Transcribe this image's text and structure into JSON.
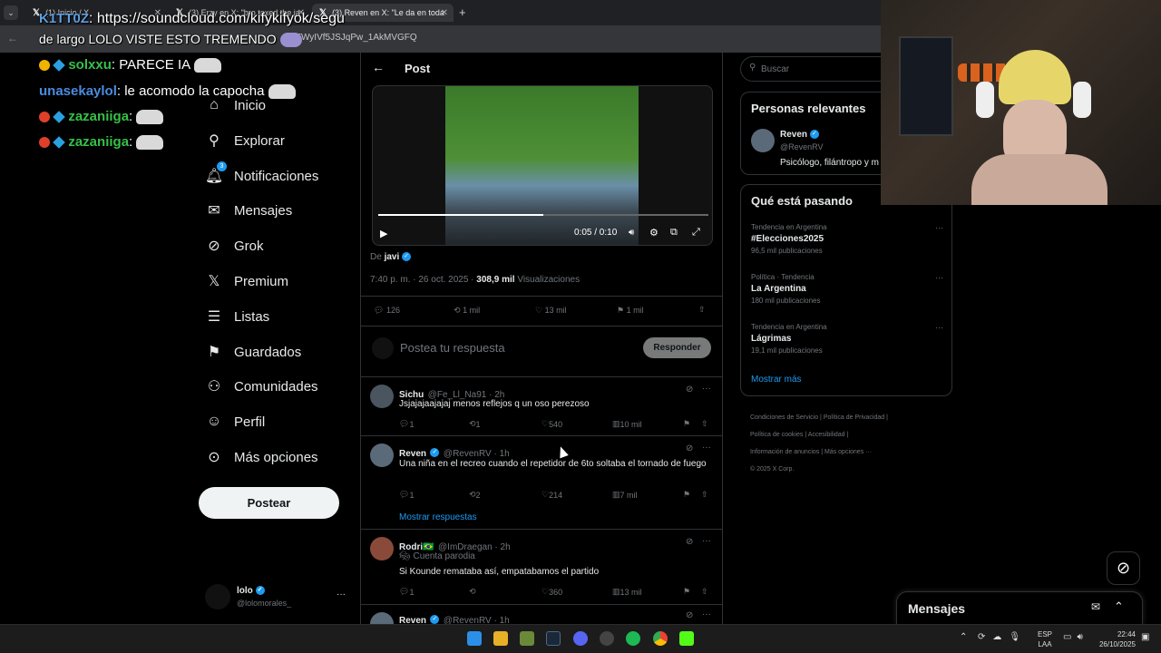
{
  "browser": {
    "tabs": [
      {
        "title": "(1) Inicio / X"
      },
      {
        "title": "(3) Erzy en X: \"bro taxed the ja"
      },
      {
        "title": "(3) Reven en X: \"Le da en toda"
      }
    ],
    "new_tab": "+",
    "url_fragment": "=TWyIVf5JSJqPw_1AkMVGFQ"
  },
  "chat": [
    {
      "name": "K1TT0Z",
      "msg": ": https://soundcloud.com/kifykifyok/segu"
    },
    {
      "name": "",
      "msg": "de largo LOLO VISTE ESTO TREMENDO"
    },
    {
      "name": "solxxu",
      "msg": ": PARECE IA"
    },
    {
      "name": "unasekaylol",
      "msg": ": le acomodo la capocha"
    },
    {
      "name": "zazaniiga",
      "msg": ":"
    },
    {
      "name": "zazaniiga",
      "msg": ":"
    }
  ],
  "nav": {
    "items": [
      {
        "label": "Inicio",
        "icon": "home-icon",
        "glyph": "⌂"
      },
      {
        "label": "Explorar",
        "icon": "search-icon",
        "glyph": "⚲"
      },
      {
        "label": "Notificaciones",
        "icon": "bell-icon",
        "glyph": "♫",
        "badge": "3"
      },
      {
        "label": "Mensajes",
        "icon": "mail-icon",
        "glyph": "✉"
      },
      {
        "label": "Grok",
        "icon": "grok-icon",
        "glyph": "⊘"
      },
      {
        "label": "Premium",
        "icon": "x-logo-icon",
        "glyph": "𝕏"
      },
      {
        "label": "Listas",
        "icon": "list-icon",
        "glyph": "☰"
      },
      {
        "label": "Guardados",
        "icon": "bookmark-icon",
        "glyph": "⚑"
      },
      {
        "label": "Comunidades",
        "icon": "people-icon",
        "glyph": "⚇"
      },
      {
        "label": "Perfil",
        "icon": "person-icon",
        "glyph": "☺"
      },
      {
        "label": "Más opciones",
        "icon": "more-circle-icon",
        "glyph": "⊙"
      }
    ],
    "post_button": "Postear",
    "account_name": "lolo",
    "account_handle": "@lolomorales_",
    "account_more": "···"
  },
  "post": {
    "header_title": "Post",
    "video_time": "0:05 / 0:10",
    "by_label": "De",
    "by_name": "javi",
    "meta_time": "7:40 p. m. · 26 oct. 2025 · ",
    "views_value": "308,9 mil",
    "views_label": "Visualizaciones",
    "stats": {
      "replies": "126",
      "reposts": "1 mil",
      "likes": "13 mil",
      "bookmarks": "1 mil"
    },
    "reply_placeholder": "Postea tu respuesta",
    "reply_button": "Responder"
  },
  "replies": [
    {
      "name": "Sichu",
      "handle": "@Fe_Ll_Na91 · 2h",
      "text": "Jsjajajaajajaj menos reflejos q un oso perezoso",
      "replies": "1",
      "reposts": "1",
      "likes": "540",
      "views": "10 mil"
    },
    {
      "name": "Reven",
      "handle": "@RevenRV · 1h",
      "text": "Una niña en el recreo cuando el repetidor de 6to soltaba el tornado de fuego",
      "replies": "1",
      "reposts": "2",
      "likes": "214",
      "views": "7 mil",
      "show_replies": "Mostrar respuestas"
    },
    {
      "name": "Rodri🇧🇷",
      "handle": "@ImDraegan · 2h",
      "tag": "Cuenta parodia",
      "text": "Si Kounde remataba así, empatabamos el partido",
      "replies": "1",
      "reposts": "",
      "likes": "360",
      "views": "13 mil"
    },
    {
      "name": "Reven",
      "handle": "@RevenRV · 1h"
    }
  ],
  "right": {
    "search_placeholder": "Buscar",
    "relevant_title": "Personas relevantes",
    "relevant_name": "Reven",
    "relevant_handle": "@RevenRV",
    "relevant_bio": "Psicólogo, filántropo y m",
    "trends_title": "Qué está pasando",
    "trends": [
      {
        "meta": "Tendencia en Argentina",
        "name": "#Elecciones2025",
        "count": "96,5 mil publicaciones"
      },
      {
        "meta": "Política · Tendencia",
        "name": "La Argentina",
        "count": "180 mil publicaciones"
      },
      {
        "meta": "Tendencia en Argentina",
        "name": "Lágrimas",
        "count": "19,1 mil publicaciones"
      }
    ],
    "show_more": "Mostrar más",
    "footer": [
      "Condiciones de Servicio",
      "Política de Privacidad",
      "Política de cookies",
      "Accesibilidad",
      "Información de anuncios",
      "Más opciones ···",
      "© 2025 X Corp."
    ],
    "messages_title": "Mensajes"
  },
  "taskbar": {
    "lang": "ESP",
    "lang2": "LAA",
    "time": "22:44",
    "date": "26/10/2025"
  },
  "colors": {
    "accent": "#1d9bf0",
    "bg": "#000000",
    "border": "#2f3336",
    "muted": "#71767b"
  }
}
